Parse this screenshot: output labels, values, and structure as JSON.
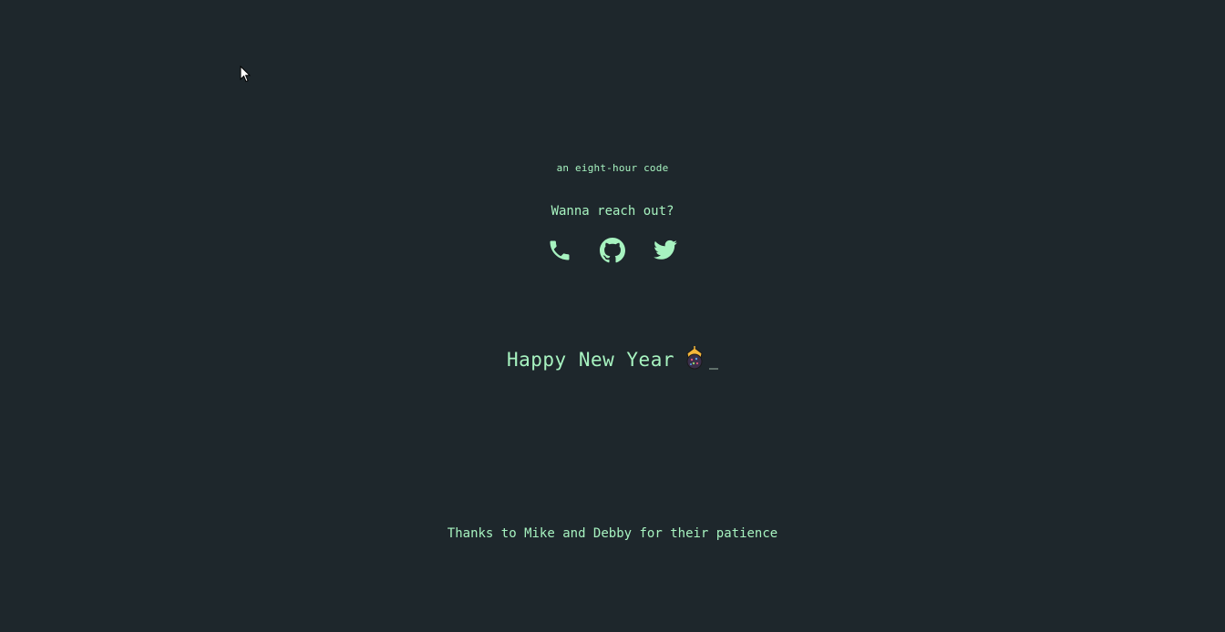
{
  "header": {
    "tagline": "an eight-hour code"
  },
  "contact": {
    "prompt": "Wanna reach out?",
    "links": [
      {
        "icon": "phone-icon"
      },
      {
        "icon": "github-icon"
      },
      {
        "icon": "twitter-icon"
      }
    ]
  },
  "greeting": {
    "text": "Happy New Year",
    "emoji_icon": "firework-bomb-icon"
  },
  "footer": {
    "thanks": "Thanks to Mike and Debby for their patience"
  },
  "colors": {
    "background": "#1e272c",
    "text": "#a7f3c0"
  }
}
